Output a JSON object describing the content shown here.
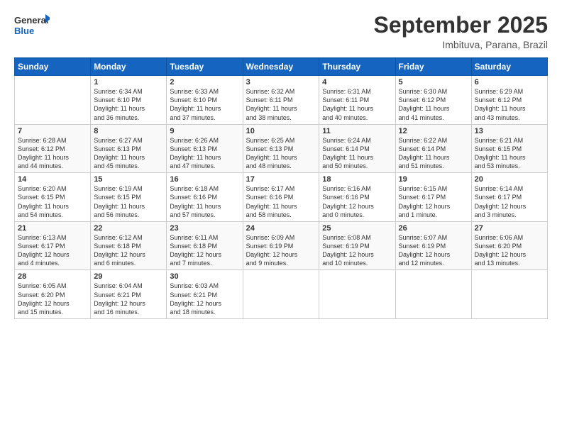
{
  "logo": {
    "line1": "General",
    "line2": "Blue"
  },
  "title": "September 2025",
  "subtitle": "Imbituva, Parana, Brazil",
  "weekdays": [
    "Sunday",
    "Monday",
    "Tuesday",
    "Wednesday",
    "Thursday",
    "Friday",
    "Saturday"
  ],
  "weeks": [
    [
      {
        "day": "",
        "info": ""
      },
      {
        "day": "1",
        "info": "Sunrise: 6:34 AM\nSunset: 6:10 PM\nDaylight: 11 hours\nand 36 minutes."
      },
      {
        "day": "2",
        "info": "Sunrise: 6:33 AM\nSunset: 6:10 PM\nDaylight: 11 hours\nand 37 minutes."
      },
      {
        "day": "3",
        "info": "Sunrise: 6:32 AM\nSunset: 6:11 PM\nDaylight: 11 hours\nand 38 minutes."
      },
      {
        "day": "4",
        "info": "Sunrise: 6:31 AM\nSunset: 6:11 PM\nDaylight: 11 hours\nand 40 minutes."
      },
      {
        "day": "5",
        "info": "Sunrise: 6:30 AM\nSunset: 6:12 PM\nDaylight: 11 hours\nand 41 minutes."
      },
      {
        "day": "6",
        "info": "Sunrise: 6:29 AM\nSunset: 6:12 PM\nDaylight: 11 hours\nand 43 minutes."
      }
    ],
    [
      {
        "day": "7",
        "info": "Sunrise: 6:28 AM\nSunset: 6:12 PM\nDaylight: 11 hours\nand 44 minutes."
      },
      {
        "day": "8",
        "info": "Sunrise: 6:27 AM\nSunset: 6:13 PM\nDaylight: 11 hours\nand 45 minutes."
      },
      {
        "day": "9",
        "info": "Sunrise: 6:26 AM\nSunset: 6:13 PM\nDaylight: 11 hours\nand 47 minutes."
      },
      {
        "day": "10",
        "info": "Sunrise: 6:25 AM\nSunset: 6:13 PM\nDaylight: 11 hours\nand 48 minutes."
      },
      {
        "day": "11",
        "info": "Sunrise: 6:24 AM\nSunset: 6:14 PM\nDaylight: 11 hours\nand 50 minutes."
      },
      {
        "day": "12",
        "info": "Sunrise: 6:22 AM\nSunset: 6:14 PM\nDaylight: 11 hours\nand 51 minutes."
      },
      {
        "day": "13",
        "info": "Sunrise: 6:21 AM\nSunset: 6:15 PM\nDaylight: 11 hours\nand 53 minutes."
      }
    ],
    [
      {
        "day": "14",
        "info": "Sunrise: 6:20 AM\nSunset: 6:15 PM\nDaylight: 11 hours\nand 54 minutes."
      },
      {
        "day": "15",
        "info": "Sunrise: 6:19 AM\nSunset: 6:15 PM\nDaylight: 11 hours\nand 56 minutes."
      },
      {
        "day": "16",
        "info": "Sunrise: 6:18 AM\nSunset: 6:16 PM\nDaylight: 11 hours\nand 57 minutes."
      },
      {
        "day": "17",
        "info": "Sunrise: 6:17 AM\nSunset: 6:16 PM\nDaylight: 11 hours\nand 58 minutes."
      },
      {
        "day": "18",
        "info": "Sunrise: 6:16 AM\nSunset: 6:16 PM\nDaylight: 12 hours\nand 0 minutes."
      },
      {
        "day": "19",
        "info": "Sunrise: 6:15 AM\nSunset: 6:17 PM\nDaylight: 12 hours\nand 1 minute."
      },
      {
        "day": "20",
        "info": "Sunrise: 6:14 AM\nSunset: 6:17 PM\nDaylight: 12 hours\nand 3 minutes."
      }
    ],
    [
      {
        "day": "21",
        "info": "Sunrise: 6:13 AM\nSunset: 6:17 PM\nDaylight: 12 hours\nand 4 minutes."
      },
      {
        "day": "22",
        "info": "Sunrise: 6:12 AM\nSunset: 6:18 PM\nDaylight: 12 hours\nand 6 minutes."
      },
      {
        "day": "23",
        "info": "Sunrise: 6:11 AM\nSunset: 6:18 PM\nDaylight: 12 hours\nand 7 minutes."
      },
      {
        "day": "24",
        "info": "Sunrise: 6:09 AM\nSunset: 6:19 PM\nDaylight: 12 hours\nand 9 minutes."
      },
      {
        "day": "25",
        "info": "Sunrise: 6:08 AM\nSunset: 6:19 PM\nDaylight: 12 hours\nand 10 minutes."
      },
      {
        "day": "26",
        "info": "Sunrise: 6:07 AM\nSunset: 6:19 PM\nDaylight: 12 hours\nand 12 minutes."
      },
      {
        "day": "27",
        "info": "Sunrise: 6:06 AM\nSunset: 6:20 PM\nDaylight: 12 hours\nand 13 minutes."
      }
    ],
    [
      {
        "day": "28",
        "info": "Sunrise: 6:05 AM\nSunset: 6:20 PM\nDaylight: 12 hours\nand 15 minutes."
      },
      {
        "day": "29",
        "info": "Sunrise: 6:04 AM\nSunset: 6:21 PM\nDaylight: 12 hours\nand 16 minutes."
      },
      {
        "day": "30",
        "info": "Sunrise: 6:03 AM\nSunset: 6:21 PM\nDaylight: 12 hours\nand 18 minutes."
      },
      {
        "day": "",
        "info": ""
      },
      {
        "day": "",
        "info": ""
      },
      {
        "day": "",
        "info": ""
      },
      {
        "day": "",
        "info": ""
      }
    ]
  ]
}
